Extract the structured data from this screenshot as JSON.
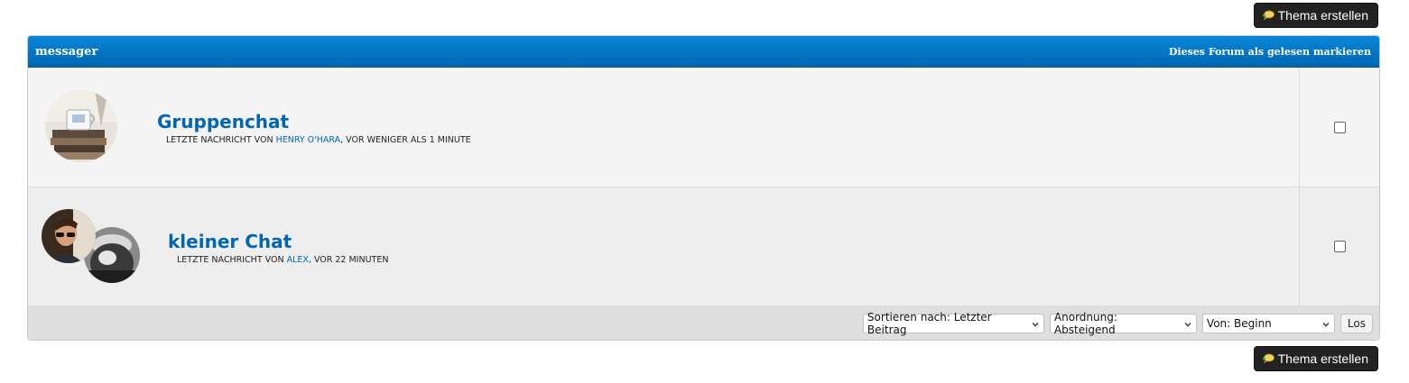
{
  "actions": {
    "new_topic_label": "Thema erstellen"
  },
  "forum": {
    "title": "messager",
    "mark_read": "Dieses Forum als gelesen markieren",
    "topics": [
      {
        "title": "Gruppenchat",
        "meta_prefix": "Letzte Nachricht von ",
        "user": "Henry O'Hara",
        "meta_suffix": ", vor weniger als 1 Minute"
      },
      {
        "title": "kleiner Chat",
        "meta_prefix": "Letzte Nachricht von ",
        "user": "Alex",
        "meta_suffix": ", vor 22 Minuten"
      }
    ]
  },
  "footer": {
    "sort_by": "Sortieren nach: Letzter Beitrag",
    "order": "Anordnung: Absteigend",
    "from": "Von: Beginn",
    "go": "Los"
  },
  "colors": {
    "header_blue": "#0a7fd0",
    "link_blue": "#0066b3",
    "button_dark": "#222222"
  },
  "icons": [
    "chat-bubble-icon",
    "checkbox-icon",
    "chevron-down-icon"
  ]
}
